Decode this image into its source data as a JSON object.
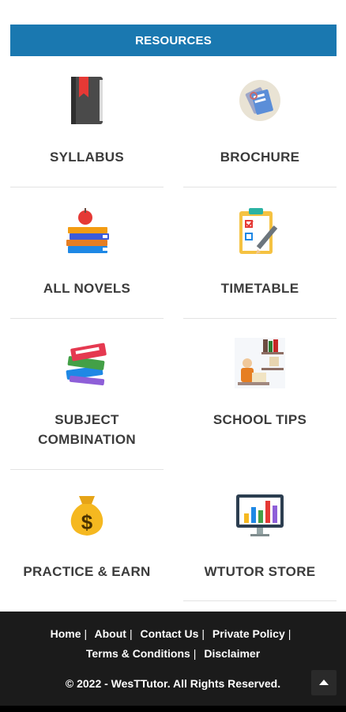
{
  "header": {
    "title": "RESOURCES",
    "color": "#1a78b0"
  },
  "tiles": [
    {
      "label": "SYLLABUS",
      "icon": "book-icon"
    },
    {
      "label": "BROCHURE",
      "icon": "brochure-icon"
    },
    {
      "label": "ALL NOVELS",
      "icon": "novels-icon"
    },
    {
      "label": "TIMETABLE",
      "icon": "clipboard-icon"
    },
    {
      "label": "SUBJECT COMBINATION",
      "icon": "books-stack-icon"
    },
    {
      "label": "SCHOOL TIPS",
      "icon": "study-icon"
    },
    {
      "label": "PRACTICE & EARN",
      "icon": "money-bag-icon"
    },
    {
      "label": "WTUTOR STORE",
      "icon": "monitor-chart-icon"
    }
  ],
  "footer": {
    "links": [
      "Home",
      "About",
      "Contact Us",
      "Private Policy",
      "Terms & Conditions",
      "Disclaimer"
    ],
    "separator": "|",
    "copyright": "© 2022 - WesTTutor. All Rights Reserved.",
    "background": "#1b1b1b"
  }
}
